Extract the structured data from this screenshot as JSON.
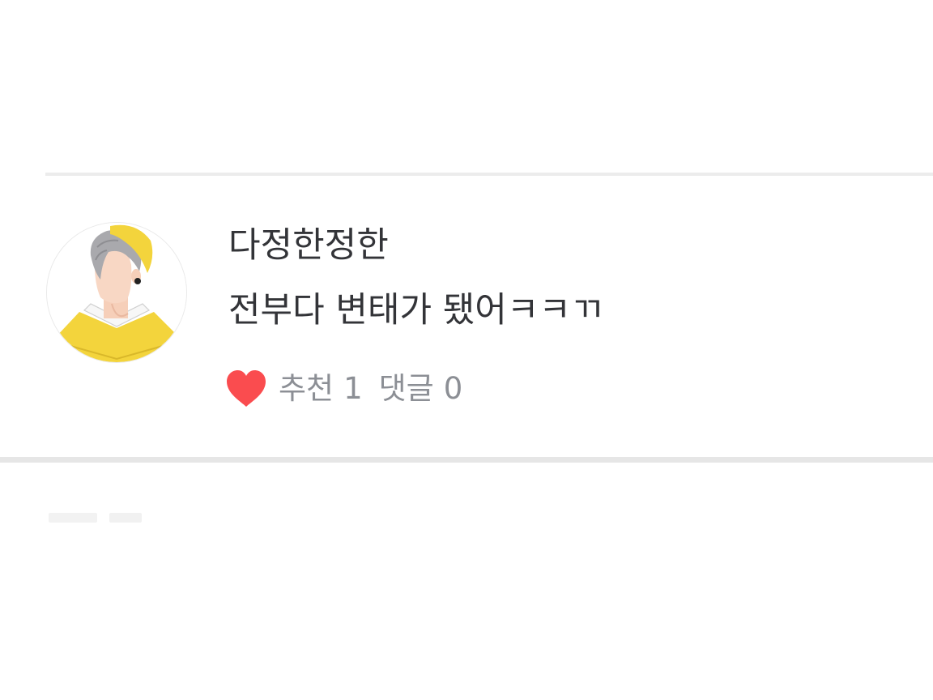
{
  "comment": {
    "username": "다정한정한",
    "text": "전부다 변태가 됐어ㅋㅋㄲ",
    "recommend_label": "추천",
    "recommend_count": "1",
    "reply_label": "댓글",
    "reply_count": "0",
    "avatar_icon": "illustrated-person-yellow-beret-avatar",
    "heart_icon": "heart-icon",
    "colors": {
      "heart": "#fa4c4f",
      "text_primary": "#333438",
      "text_meta": "#8c8f95",
      "avatar_accent": "#f3d43c"
    }
  }
}
